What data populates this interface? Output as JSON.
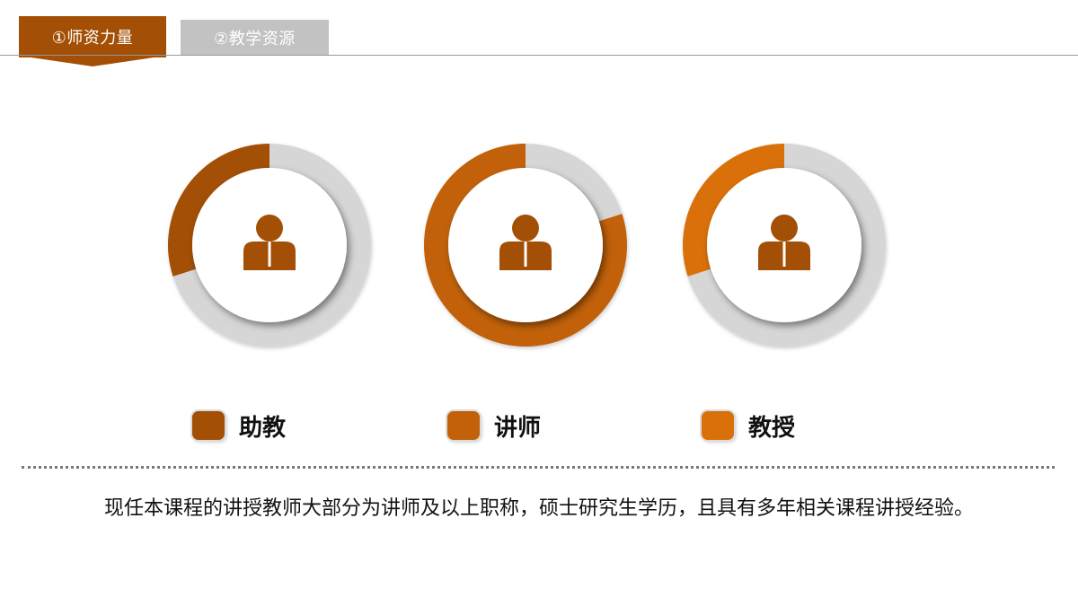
{
  "tabs": [
    {
      "label": "①师资力量",
      "active": true
    },
    {
      "label": "②教学资源",
      "active": false
    }
  ],
  "colors": {
    "accent": "#a34f05",
    "track": "#d6d6d6",
    "inactive_tab": "#c2c2c2"
  },
  "chart_data": {
    "type": "donut",
    "series": [
      {
        "name": "助教",
        "fraction": 0.3,
        "color": "#a34f05",
        "icon": "person-icon"
      },
      {
        "name": "讲师",
        "fraction": 0.8,
        "color": "#c2610a",
        "icon": "person-icon"
      },
      {
        "name": "教授",
        "fraction": 0.3,
        "color": "#d97009",
        "icon": "person-icon"
      }
    ]
  },
  "summary": "现任本课程的讲授教师大部分为讲师及以上职称，硕士研究生学历，且具有多年相关课程讲授经验。"
}
